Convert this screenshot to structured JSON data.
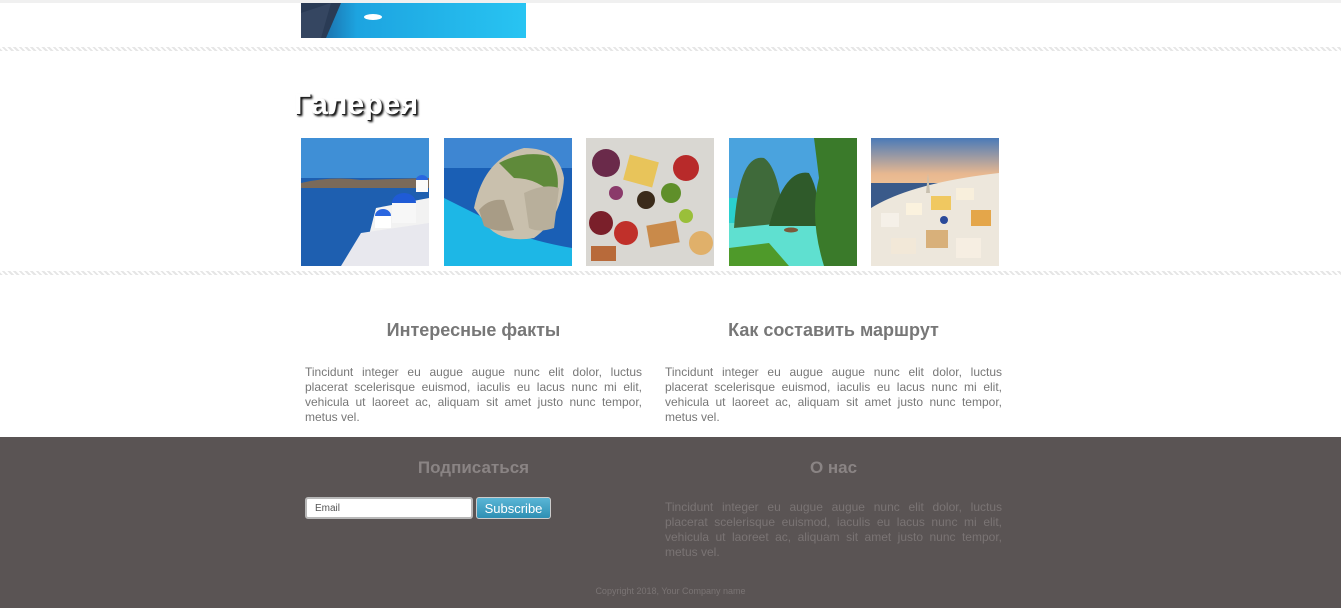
{
  "gallery": {
    "title": "Галерея",
    "images": [
      {
        "alt": "santorini-blue-domes"
      },
      {
        "alt": "navagio-beach-cliff"
      },
      {
        "alt": "food-platter"
      },
      {
        "alt": "tropical-lagoon"
      },
      {
        "alt": "oia-village-sunset"
      }
    ]
  },
  "facts": {
    "title": "Интересные факты",
    "text": "Tincidunt integer eu augue augue nunc elit dolor, luctus placerat scelerisque euismod, iaculis eu lacus nunc mi elit, vehicula ut laoreet ac, aliquam sit amet justo nunc tempor, metus vel."
  },
  "route": {
    "title": "Как составить маршрут",
    "text": "Tincidunt integer eu augue augue nunc elit dolor, luctus placerat scelerisque euismod, iaculis eu lacus nunc mi elit, vehicula ut laoreet ac, aliquam sit amet justo nunc tempor, metus vel."
  },
  "footer": {
    "subscribe_title": "Подписаться",
    "email_placeholder": "Email",
    "subscribe_button": "Subscribe",
    "about_title": "О нас",
    "about_text": "Tincidunt integer eu augue augue nunc elit dolor, luctus placerat scelerisque euismod, iaculis eu lacus nunc mi elit, vehicula ut laoreet ac, aliquam sit amet justo nunc tempor, metus vel.",
    "copyright": "Copyright 2018, Your Company name"
  },
  "colors": {
    "footer_bg": "#5a5454",
    "button_blue": "#2e8fb3",
    "text_gray": "#777777"
  }
}
